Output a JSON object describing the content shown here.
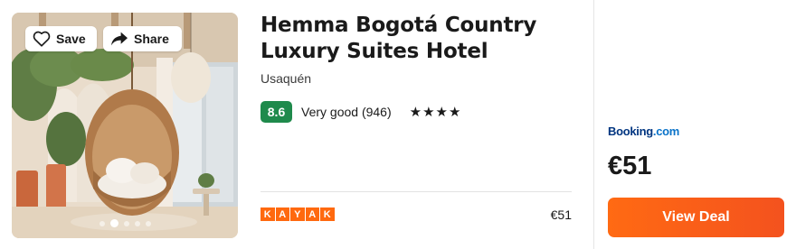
{
  "photo": {
    "save_label": "Save",
    "share_label": "Share",
    "carousel_count": 5,
    "carousel_active_index": 1
  },
  "hotel": {
    "name": "Hemma Bogotá Country Luxury Suites Hotel",
    "location": "Usaquén",
    "score": "8.6",
    "rating_text": "Very good (946)",
    "stars": "★★★★",
    "star_count": 4
  },
  "provider": {
    "logo_letters": [
      "K",
      "A",
      "Y",
      "A",
      "K"
    ],
    "price": "€51"
  },
  "deal": {
    "site_name": "Booking",
    "site_suffix": ".com",
    "price": "€51",
    "button_label": "View Deal"
  },
  "colors": {
    "score_badge": "#1f8a4c",
    "kayak_orange": "#ff690f",
    "booking_blue": "#003580",
    "cta_orange": "#ff6a13"
  }
}
